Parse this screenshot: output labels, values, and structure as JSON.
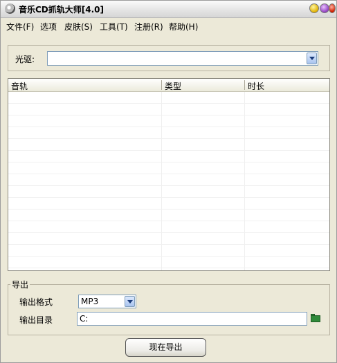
{
  "window": {
    "title": "音乐CD抓轨大师[4.0]"
  },
  "menu": [
    "文件(F)",
    "选项",
    "皮肤(S)",
    "工具(T)",
    "注册(R)",
    "帮助(H)"
  ],
  "drive": {
    "label": "光驱:",
    "value": ""
  },
  "track_list": {
    "columns": [
      "音轨",
      "类型",
      "时长"
    ],
    "rows": []
  },
  "export": {
    "group_label": "导出",
    "format_label": "输出格式",
    "format_value": "MP3",
    "dir_label": "输出目录",
    "dir_value": "C:"
  },
  "action": {
    "export_now": "现在导出"
  }
}
